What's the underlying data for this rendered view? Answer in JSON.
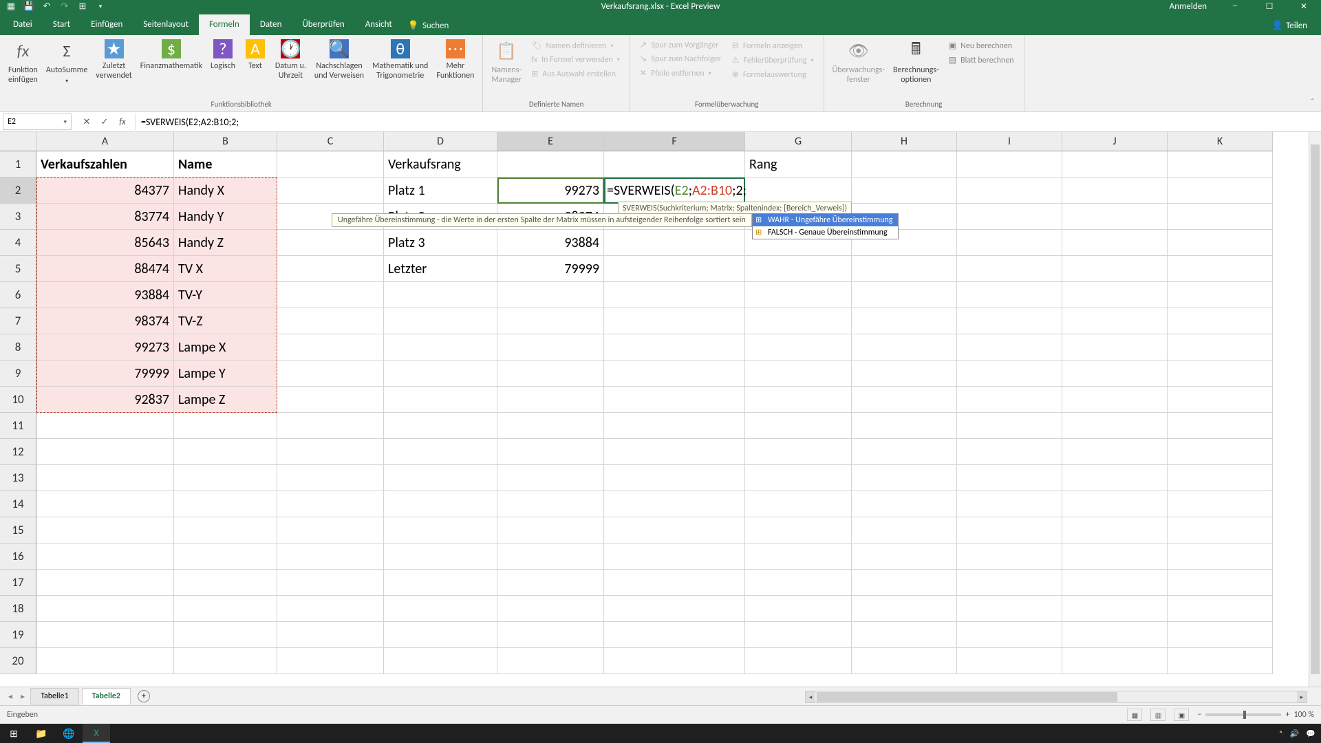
{
  "title": "Verkaufsrang.xlsx - Excel Preview",
  "signin": "Anmelden",
  "tabs": {
    "datei": "Datei",
    "start": "Start",
    "einf": "Einfügen",
    "seiten": "Seitenlayout",
    "formeln": "Formeln",
    "daten": "Daten",
    "ueber": "Überprüfen",
    "ansicht": "Ansicht",
    "suchen": "Suchen",
    "teilen": "Teilen"
  },
  "ribbon": {
    "fn_einf": "Funktion\neinfügen",
    "autosumme": "AutoSumme",
    "zuletzt": "Zuletzt\nverwendet",
    "finanz": "Finanzmathematik",
    "logisch": "Logisch",
    "text": "Text",
    "datum": "Datum u.\nUhrzeit",
    "nachschl": "Nachschlagen\nund Verweisen",
    "math": "Mathematik und\nTrigonometrie",
    "mehr": "Mehr\nFunktionen",
    "grp_bib": "Funktionsbibliothek",
    "namens": "Namens-\nManager",
    "def1": "Namen definieren",
    "def2": "In Formel verwenden",
    "def3": "Aus Auswahl erstellen",
    "grp_def": "Definierte Namen",
    "spur1": "Spur zum Vorgänger",
    "spur2": "Spur zum Nachfolger",
    "spur3": "Pfeile entfernen",
    "fa1": "Formeln anzeigen",
    "fa2": "Fehlerüberprüfung",
    "fa3": "Formelauswertung",
    "grp_fa": "Formelüberwachung",
    "uf": "Überwachungs-\nfenster",
    "bo": "Berechnungs-\noptionen",
    "neu": "Neu berechnen",
    "blatt": "Blatt berechnen",
    "grp_ber": "Berechnung"
  },
  "namebox": "E2",
  "formula": "=SVERWEIS(E2;A2:B10;2;",
  "colwidths": {
    "A": 200,
    "B": 150,
    "C": 155,
    "D": 165,
    "E": 155,
    "F": 205,
    "G": 155,
    "H": 153,
    "I": 153,
    "J": 153,
    "K": 153
  },
  "cols": [
    "A",
    "B",
    "C",
    "D",
    "E",
    "F",
    "G",
    "H",
    "I",
    "J",
    "K"
  ],
  "rows": 20,
  "data": {
    "A1": "Verkaufszahlen",
    "B1": "Name",
    "D1": "Verkaufsrang",
    "G1": "Rang",
    "A2": "84377",
    "B2": "Handy X",
    "D2": "Platz 1",
    "E2": "99273",
    "A3": "83774",
    "B3": "Handy Y",
    "D3": "Platz 2",
    "E3": "98374",
    "A4": "85643",
    "B4": "Handy Z",
    "D4": "Platz 3",
    "E4": "93884",
    "A5": "88474",
    "B5": "TV X",
    "D5": "Letzter",
    "E5": "79999",
    "A6": "93884",
    "B6": "TV-Y",
    "A7": "98374",
    "B7": "TV-Z",
    "A8": "99273",
    "B8": "Lampe X",
    "A9": "79999",
    "B9": "Lampe Y",
    "A10": "92837",
    "B10": "Lampe Z"
  },
  "formula_f2": {
    "pre": "=SVERWEIS(",
    "e2": "E2",
    "sep1": ";",
    "ab": "A2:B10",
    "sep2": ";",
    "two": "2",
    "sep3": ";"
  },
  "sig": "SVERWEIS(Suchkriterium; Matrix; Spaltenindex; [Bereich_Verweis])",
  "approx": "Ungefähre Übereinstimmung - die Werte in der ersten Spalte der Matrix müssen in aufsteigender Reihenfolge sortiert sein",
  "ac": {
    "wahr": "WAHR - Ungefähre Übereinstimmung",
    "falsch": "FALSCH - Genaue Übereinstimmung"
  },
  "sheets": {
    "t1": "Tabelle1",
    "t2": "Tabelle2"
  },
  "status": "Eingeben",
  "zoom": "100 %"
}
